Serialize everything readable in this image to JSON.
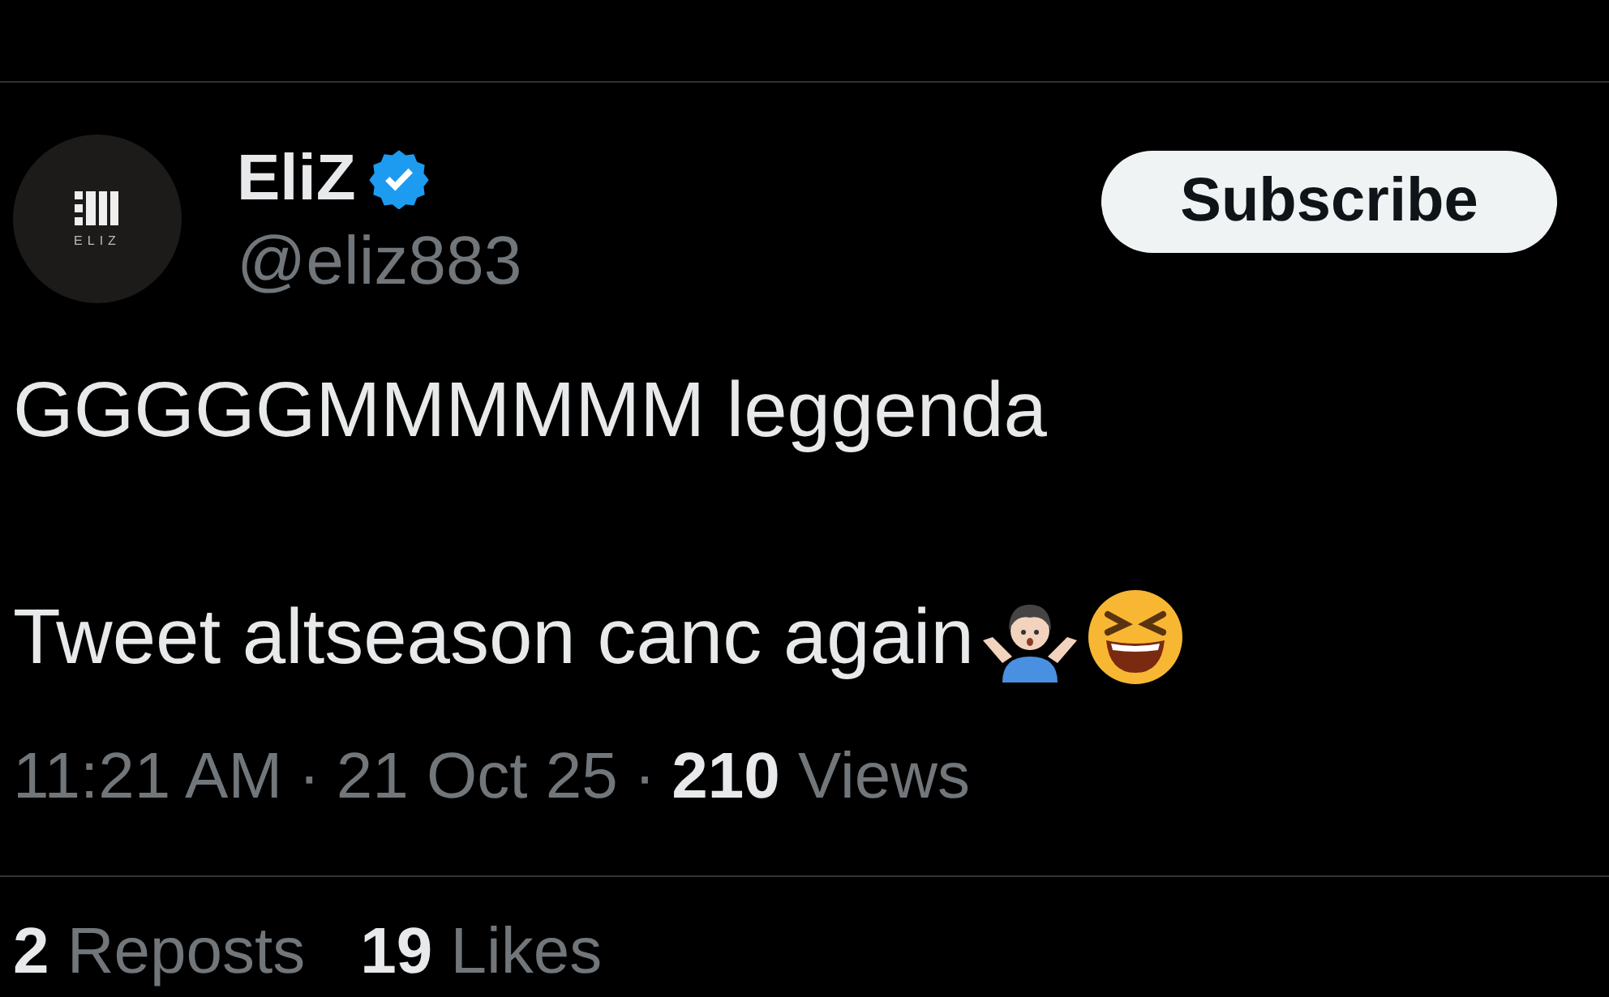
{
  "author": {
    "name": "EliZ",
    "verified": true,
    "handle": "@eliz883",
    "avatar_text": "ELIZ"
  },
  "subscribe_button": {
    "label": "Subscribe"
  },
  "tweet_lines": [
    {
      "text": "GGGGGMMMMMM leggenda"
    },
    {
      "text": "Tweet altseason canc again",
      "emojis": [
        {
          "kind": "shrug"
        },
        {
          "kind": "laugh"
        }
      ]
    }
  ],
  "meta": {
    "time": "11:21 AM",
    "separator": "·",
    "date": "21 Oct 25",
    "views_count": "210",
    "views_label": "Views"
  },
  "stats": [
    {
      "count": "2",
      "label": "Reposts"
    },
    {
      "count": "19",
      "label": "Likes"
    }
  ]
}
